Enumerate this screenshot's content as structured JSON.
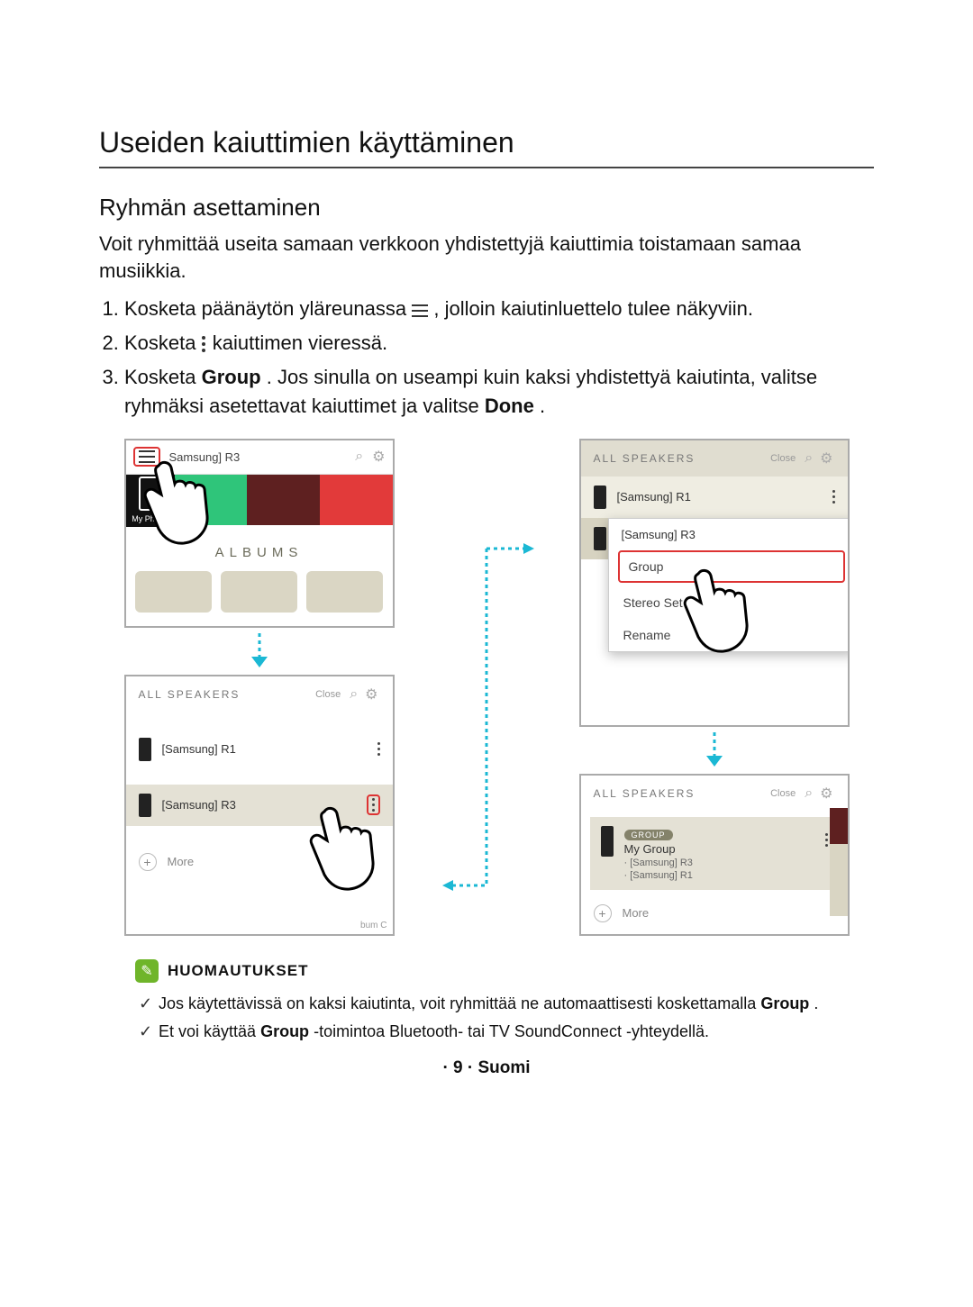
{
  "page": {
    "title": "Useiden kaiuttimien käyttäminen",
    "subtitle": "Ryhmän asettaminen",
    "intro": "Voit ryhmittää useita samaan verkkoon yhdistettyjä kaiuttimia toistamaan samaa musiikkia.",
    "steps": {
      "s1a": "Kosketa päänäytön yläreunassa ",
      "s1b": ", jolloin kaiutinluettelo tulee näkyviin.",
      "s2a": "Kosketa ",
      "s2b": " kaiuttimen vieressä.",
      "s3a": "Kosketa ",
      "s3_group": "Group",
      "s3b": ". Jos sinulla on useampi kuin kaksi yhdistettyä kaiutinta, valitse ryhmäksi asetettavat kaiuttimet ja valitse ",
      "s3_done": "Done",
      "s3c": "."
    },
    "footer": "· 9 · Suomi"
  },
  "notes": {
    "title": "HUOMAUTUKSET",
    "n1a": "Jos käytettävissä on kaksi kaiutinta, voit ryhmittää ne automaattisesti koskettamalla ",
    "n1_group": "Group",
    "n1b": ".",
    "n2a": "Et voi käyttää ",
    "n2_group": "Group",
    "n2b": " -toimintoa Bluetooth- tai TV SoundConnect -yhteydellä."
  },
  "fig1": {
    "title": "Samsung] R3",
    "myphone": "My Phone",
    "albums": "ALBUMS"
  },
  "fig2": {
    "panel": "ALL SPEAKERS",
    "close": "Close",
    "r1": "[Samsung] R1",
    "r3": "[Samsung] R3",
    "more": "More",
    "bum": "bum C"
  },
  "fig3": {
    "panel": "ALL SPEAKERS",
    "close": "Close",
    "r1": "[Samsung] R1",
    "r3": "[Samsung] R3",
    "popup_title": "[Samsung] R3",
    "popup_group": "Group",
    "popup_stereo": "Stereo Set",
    "popup_rename": "Rename"
  },
  "fig4": {
    "panel": "ALL SPEAKERS",
    "close": "Close",
    "badge": "GROUP",
    "group_name": "My Group",
    "member1": "· [Samsung] R3",
    "member2": "· [Samsung] R1",
    "more": "More"
  }
}
